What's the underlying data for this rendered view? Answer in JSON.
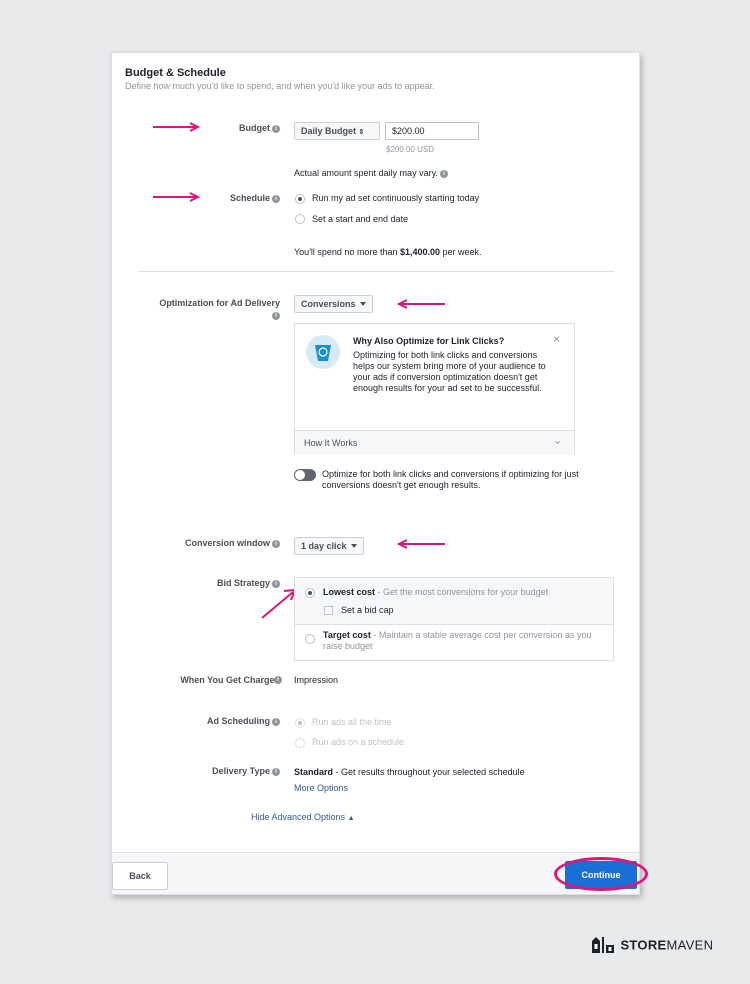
{
  "header": {
    "title": "Budget & Schedule",
    "subtitle": "Define how much you'd like to spend, and when you'd like your ads to appear."
  },
  "budget": {
    "label": "Budget",
    "type_select": "Daily Budget",
    "amount_value": "$200.00",
    "amount_note": "$200.00 USD",
    "note": "Actual amount spent daily may vary."
  },
  "schedule": {
    "label": "Schedule",
    "option_continuous": "Run my ad set continuously starting today",
    "option_start_end": "Set a start and end date",
    "spend_prefix": "You'll spend no more than ",
    "spend_amount": "$1,400.00",
    "spend_suffix": " per week."
  },
  "optimization": {
    "label": "Optimization for Ad Delivery",
    "select": "Conversions",
    "tip_title": "Why Also Optimize for Link Clicks?",
    "tip_body": "Optimizing for both link clicks and conversions helps our system bring more of your audience to your ads if conversion optimization doesn't get enough results for your ad set to be successful.",
    "tip_link": "How It Works",
    "toggle_text": "Optimize for both link clicks and conversions if optimizing for just conversions doesn't get enough results."
  },
  "conversion_window": {
    "label": "Conversion window",
    "select": "1 day click"
  },
  "bid_strategy": {
    "label": "Bid Strategy",
    "lowest_title": "Lowest cost",
    "lowest_desc": " - Get the most conversions for your budget",
    "bid_cap": "Set a bid cap",
    "target_title": "Target cost",
    "target_desc": " - Maintain a stable average cost per conversion as you raise budget"
  },
  "charged": {
    "label": "When You Get Charged",
    "value": "Impression"
  },
  "ad_scheduling": {
    "label": "Ad Scheduling",
    "option_all": "Run ads all the time",
    "option_schedule": "Run ads on a schedule"
  },
  "delivery": {
    "label": "Delivery Type",
    "value_bold": "Standard",
    "value_rest": " - Get results throughout your selected schedule",
    "more": "More Options"
  },
  "advanced_toggle": "Hide Advanced Options",
  "footer": {
    "back": "Back",
    "continue": "Continue"
  },
  "brand": {
    "name_bold": "STORE",
    "name_rest": "MAVEN"
  },
  "colors": {
    "annotation": "#e0157a",
    "primary": "#1a6fd6",
    "link": "#365899"
  }
}
